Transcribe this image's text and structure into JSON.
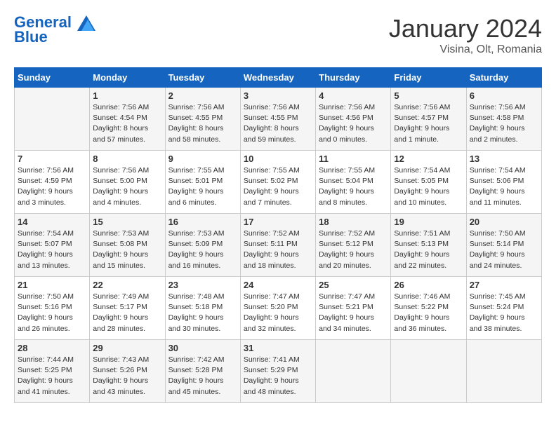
{
  "header": {
    "logo_line1": "General",
    "logo_line2": "Blue",
    "month": "January 2024",
    "location": "Visina, Olt, Romania"
  },
  "weekdays": [
    "Sunday",
    "Monday",
    "Tuesday",
    "Wednesday",
    "Thursday",
    "Friday",
    "Saturday"
  ],
  "weeks": [
    [
      {
        "num": "",
        "info": ""
      },
      {
        "num": "1",
        "info": "Sunrise: 7:56 AM\nSunset: 4:54 PM\nDaylight: 8 hours\nand 57 minutes."
      },
      {
        "num": "2",
        "info": "Sunrise: 7:56 AM\nSunset: 4:55 PM\nDaylight: 8 hours\nand 58 minutes."
      },
      {
        "num": "3",
        "info": "Sunrise: 7:56 AM\nSunset: 4:55 PM\nDaylight: 8 hours\nand 59 minutes."
      },
      {
        "num": "4",
        "info": "Sunrise: 7:56 AM\nSunset: 4:56 PM\nDaylight: 9 hours\nand 0 minutes."
      },
      {
        "num": "5",
        "info": "Sunrise: 7:56 AM\nSunset: 4:57 PM\nDaylight: 9 hours\nand 1 minute."
      },
      {
        "num": "6",
        "info": "Sunrise: 7:56 AM\nSunset: 4:58 PM\nDaylight: 9 hours\nand 2 minutes."
      }
    ],
    [
      {
        "num": "7",
        "info": "Sunrise: 7:56 AM\nSunset: 4:59 PM\nDaylight: 9 hours\nand 3 minutes."
      },
      {
        "num": "8",
        "info": "Sunrise: 7:56 AM\nSunset: 5:00 PM\nDaylight: 9 hours\nand 4 minutes."
      },
      {
        "num": "9",
        "info": "Sunrise: 7:55 AM\nSunset: 5:01 PM\nDaylight: 9 hours\nand 6 minutes."
      },
      {
        "num": "10",
        "info": "Sunrise: 7:55 AM\nSunset: 5:02 PM\nDaylight: 9 hours\nand 7 minutes."
      },
      {
        "num": "11",
        "info": "Sunrise: 7:55 AM\nSunset: 5:04 PM\nDaylight: 9 hours\nand 8 minutes."
      },
      {
        "num": "12",
        "info": "Sunrise: 7:54 AM\nSunset: 5:05 PM\nDaylight: 9 hours\nand 10 minutes."
      },
      {
        "num": "13",
        "info": "Sunrise: 7:54 AM\nSunset: 5:06 PM\nDaylight: 9 hours\nand 11 minutes."
      }
    ],
    [
      {
        "num": "14",
        "info": "Sunrise: 7:54 AM\nSunset: 5:07 PM\nDaylight: 9 hours\nand 13 minutes."
      },
      {
        "num": "15",
        "info": "Sunrise: 7:53 AM\nSunset: 5:08 PM\nDaylight: 9 hours\nand 15 minutes."
      },
      {
        "num": "16",
        "info": "Sunrise: 7:53 AM\nSunset: 5:09 PM\nDaylight: 9 hours\nand 16 minutes."
      },
      {
        "num": "17",
        "info": "Sunrise: 7:52 AM\nSunset: 5:11 PM\nDaylight: 9 hours\nand 18 minutes."
      },
      {
        "num": "18",
        "info": "Sunrise: 7:52 AM\nSunset: 5:12 PM\nDaylight: 9 hours\nand 20 minutes."
      },
      {
        "num": "19",
        "info": "Sunrise: 7:51 AM\nSunset: 5:13 PM\nDaylight: 9 hours\nand 22 minutes."
      },
      {
        "num": "20",
        "info": "Sunrise: 7:50 AM\nSunset: 5:14 PM\nDaylight: 9 hours\nand 24 minutes."
      }
    ],
    [
      {
        "num": "21",
        "info": "Sunrise: 7:50 AM\nSunset: 5:16 PM\nDaylight: 9 hours\nand 26 minutes."
      },
      {
        "num": "22",
        "info": "Sunrise: 7:49 AM\nSunset: 5:17 PM\nDaylight: 9 hours\nand 28 minutes."
      },
      {
        "num": "23",
        "info": "Sunrise: 7:48 AM\nSunset: 5:18 PM\nDaylight: 9 hours\nand 30 minutes."
      },
      {
        "num": "24",
        "info": "Sunrise: 7:47 AM\nSunset: 5:20 PM\nDaylight: 9 hours\nand 32 minutes."
      },
      {
        "num": "25",
        "info": "Sunrise: 7:47 AM\nSunset: 5:21 PM\nDaylight: 9 hours\nand 34 minutes."
      },
      {
        "num": "26",
        "info": "Sunrise: 7:46 AM\nSunset: 5:22 PM\nDaylight: 9 hours\nand 36 minutes."
      },
      {
        "num": "27",
        "info": "Sunrise: 7:45 AM\nSunset: 5:24 PM\nDaylight: 9 hours\nand 38 minutes."
      }
    ],
    [
      {
        "num": "28",
        "info": "Sunrise: 7:44 AM\nSunset: 5:25 PM\nDaylight: 9 hours\nand 41 minutes."
      },
      {
        "num": "29",
        "info": "Sunrise: 7:43 AM\nSunset: 5:26 PM\nDaylight: 9 hours\nand 43 minutes."
      },
      {
        "num": "30",
        "info": "Sunrise: 7:42 AM\nSunset: 5:28 PM\nDaylight: 9 hours\nand 45 minutes."
      },
      {
        "num": "31",
        "info": "Sunrise: 7:41 AM\nSunset: 5:29 PM\nDaylight: 9 hours\nand 48 minutes."
      },
      {
        "num": "",
        "info": ""
      },
      {
        "num": "",
        "info": ""
      },
      {
        "num": "",
        "info": ""
      }
    ]
  ]
}
